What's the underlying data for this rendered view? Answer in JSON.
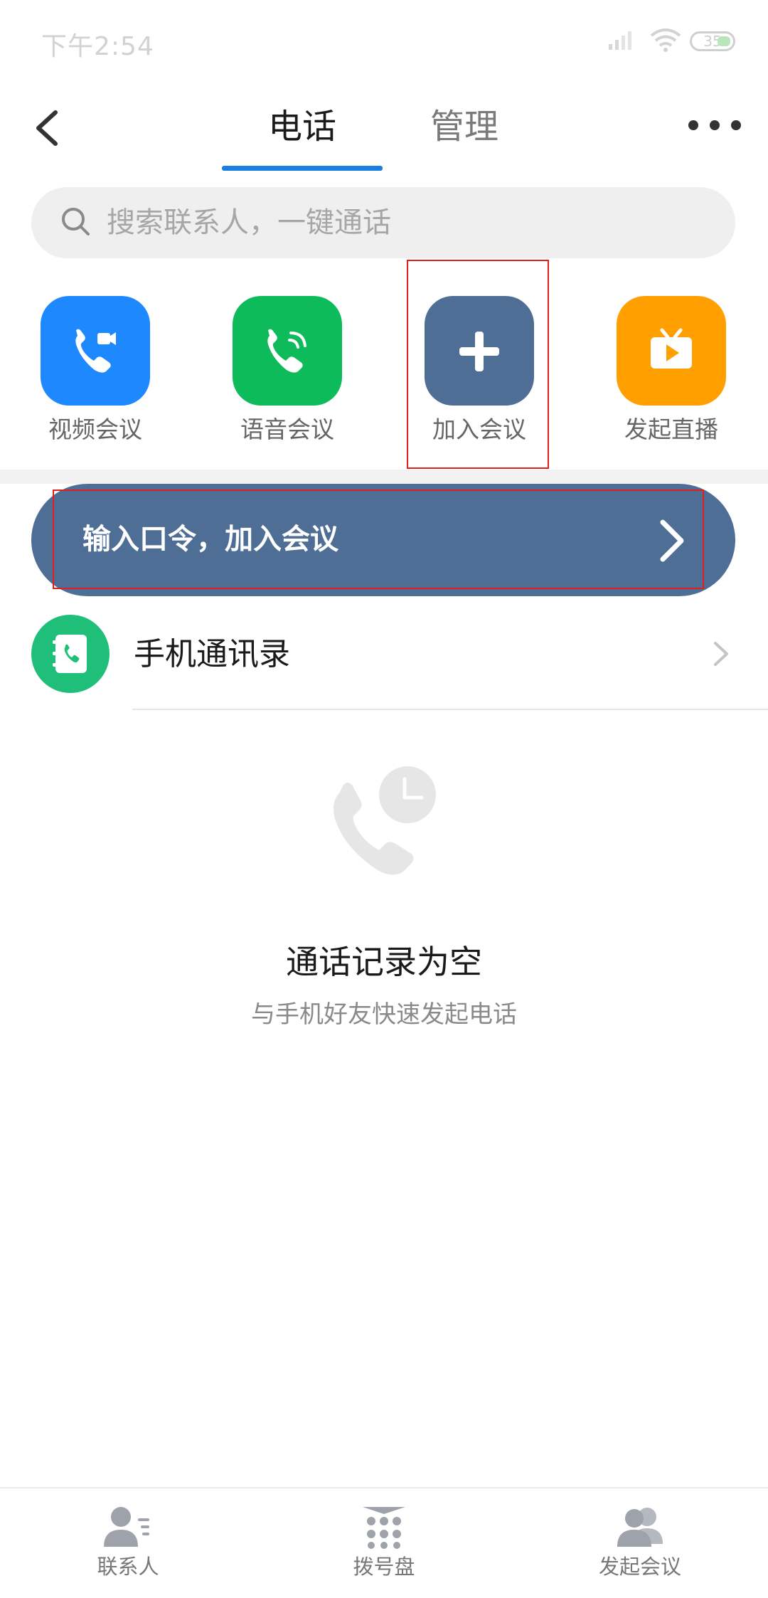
{
  "status_bar": {
    "time": "下午2:54",
    "battery_level": "35",
    "icons": [
      "signal-icon",
      "wifi-icon",
      "battery-icon"
    ]
  },
  "header": {
    "back_icon": "back-arrow-icon",
    "tabs": [
      {
        "label": "电话",
        "active": true
      },
      {
        "label": "管理",
        "active": false
      }
    ],
    "more_icon": "more-dots-icon",
    "accent_color": "#1a7fe0"
  },
  "search": {
    "placeholder": "搜索联系人，一键通话",
    "icon": "search-icon"
  },
  "quick_actions": [
    {
      "label": "视频会议",
      "icon": "video-call-icon",
      "color": "#1e88ff"
    },
    {
      "label": "语音会议",
      "icon": "voice-call-icon",
      "color": "#0dbb5a"
    },
    {
      "label": "加入会议",
      "icon": "plus-icon",
      "color": "#4f6e96"
    },
    {
      "label": "发起直播",
      "icon": "tv-play-icon",
      "color": "#ffa000"
    }
  ],
  "join_banner": {
    "label": "输入口令，加入会议",
    "icon": "chevron-right-icon",
    "color": "#4f6e96"
  },
  "contacts_row": {
    "label": "手机通讯录",
    "icon": "phonebook-icon",
    "chevron_icon": "chevron-right-icon"
  },
  "empty_state": {
    "icon": "phone-clock-icon",
    "title": "通话记录为空",
    "subtitle": "与手机好友快速发起电话"
  },
  "bottom_nav": [
    {
      "label": "联系人",
      "icon": "contacts-icon"
    },
    {
      "label": "拨号盘",
      "icon": "dialpad-icon"
    },
    {
      "label": "发起会议",
      "icon": "group-meeting-icon"
    }
  ]
}
